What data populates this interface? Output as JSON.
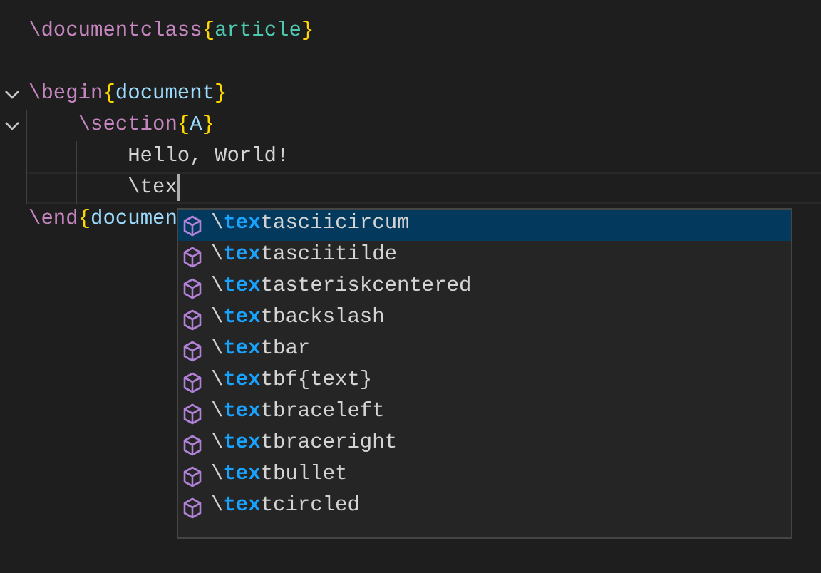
{
  "editor": {
    "lines": [
      {
        "kind": "code",
        "current": false,
        "tokens": [
          {
            "kind": "command",
            "text": "\\documentclass"
          },
          {
            "kind": "brace",
            "text": "{"
          },
          {
            "kind": "class",
            "text": "article"
          },
          {
            "kind": "brace",
            "text": "}"
          }
        ]
      },
      {
        "kind": "blank",
        "current": false
      },
      {
        "kind": "fold",
        "expanded": true,
        "current": false,
        "tokens": [
          {
            "kind": "command",
            "text": "\\begin"
          },
          {
            "kind": "brace",
            "text": "{"
          },
          {
            "kind": "argument",
            "text": "document"
          },
          {
            "kind": "brace",
            "text": "}"
          }
        ],
        "children": [
          {
            "kind": "fold",
            "expanded": true,
            "current": false,
            "tokens": [
              {
                "kind": "command",
                "text": "\\section"
              },
              {
                "kind": "brace",
                "text": "{"
              },
              {
                "kind": "argument",
                "text": "A"
              },
              {
                "kind": "brace",
                "text": "}"
              }
            ],
            "children": [
              {
                "kind": "code",
                "current": false,
                "tokens": [
                  {
                    "kind": "text",
                    "text": "Hello, World!"
                  }
                ]
              },
              {
                "kind": "code",
                "current": true,
                "tokens": [
                  {
                    "kind": "text",
                    "text": "\\tex"
                  }
                ]
              }
            ]
          }
        ]
      },
      {
        "kind": "code",
        "current": false,
        "tokens": [
          {
            "kind": "command",
            "text": "\\end"
          },
          {
            "kind": "brace",
            "text": "{"
          },
          {
            "kind": "argument",
            "text": "documen"
          }
        ]
      }
    ]
  },
  "suggestions": [
    {
      "prefix": "\\",
      "match": "tex",
      "rest": "tasciicircum",
      "selected": true
    },
    {
      "prefix": "\\",
      "match": "tex",
      "rest": "tasciitilde",
      "selected": false
    },
    {
      "prefix": "\\",
      "match": "tex",
      "rest": "tasteriskcentered",
      "selected": false
    },
    {
      "prefix": "\\",
      "match": "tex",
      "rest": "tbackslash",
      "selected": false
    },
    {
      "prefix": "\\",
      "match": "tex",
      "rest": "tbar",
      "selected": false
    },
    {
      "prefix": "\\",
      "match": "tex",
      "rest": "tbf{text}",
      "selected": false
    },
    {
      "prefix": "\\",
      "match": "tex",
      "rest": "tbraceleft",
      "selected": false
    },
    {
      "prefix": "\\",
      "match": "tex",
      "rest": "tbraceright",
      "selected": false
    },
    {
      "prefix": "\\",
      "match": "tex",
      "rest": "tbullet",
      "selected": false
    },
    {
      "prefix": "\\",
      "match": "tex",
      "rest": "tcircled",
      "selected": false
    }
  ]
}
